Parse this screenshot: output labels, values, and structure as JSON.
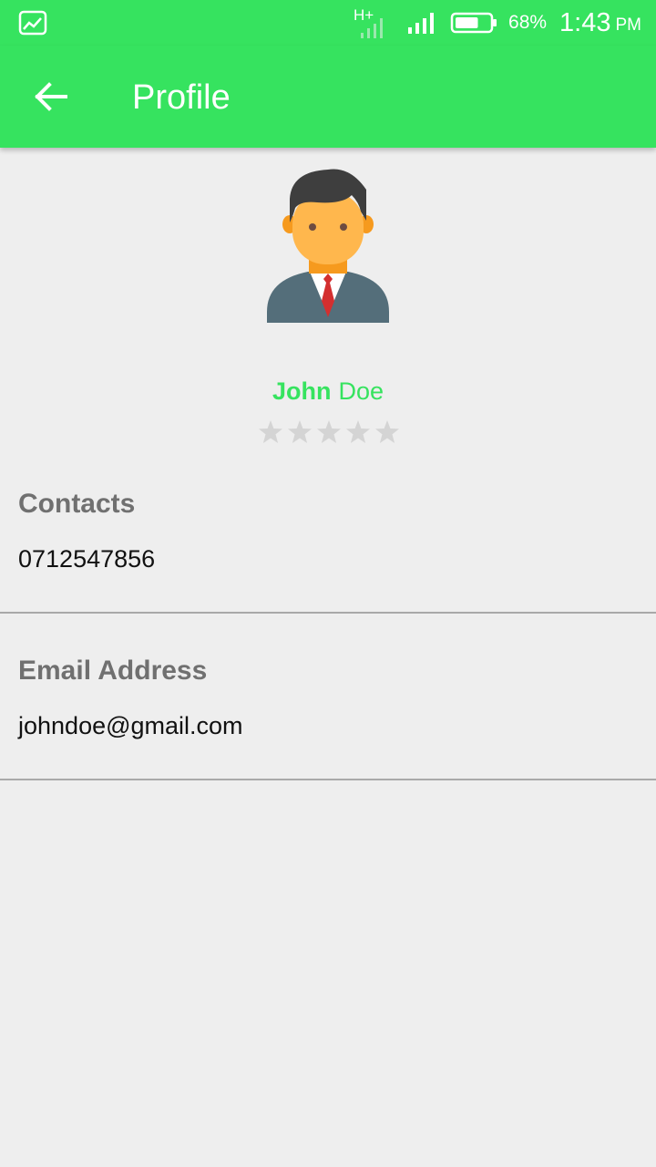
{
  "status_bar": {
    "network": "H+",
    "battery_percent": "68%",
    "time": "1:43",
    "ampm": "PM",
    "icons": [
      "gallery-icon",
      "mobile-data-icon",
      "signal-icon",
      "battery-icon"
    ]
  },
  "app_bar": {
    "title": "Profile",
    "back_icon": "arrow-left-icon"
  },
  "colors": {
    "accent": "#36e35f",
    "background": "#eeeeee",
    "label": "#707070",
    "star_empty": "#d4d4d4"
  },
  "profile": {
    "first_name": "John",
    "last_name": "Doe",
    "rating": 0,
    "rating_max": 5
  },
  "contacts": {
    "label": "Contacts",
    "value": "0712547856"
  },
  "email": {
    "label": "Email Address",
    "value": "johndoe@gmail.com"
  }
}
